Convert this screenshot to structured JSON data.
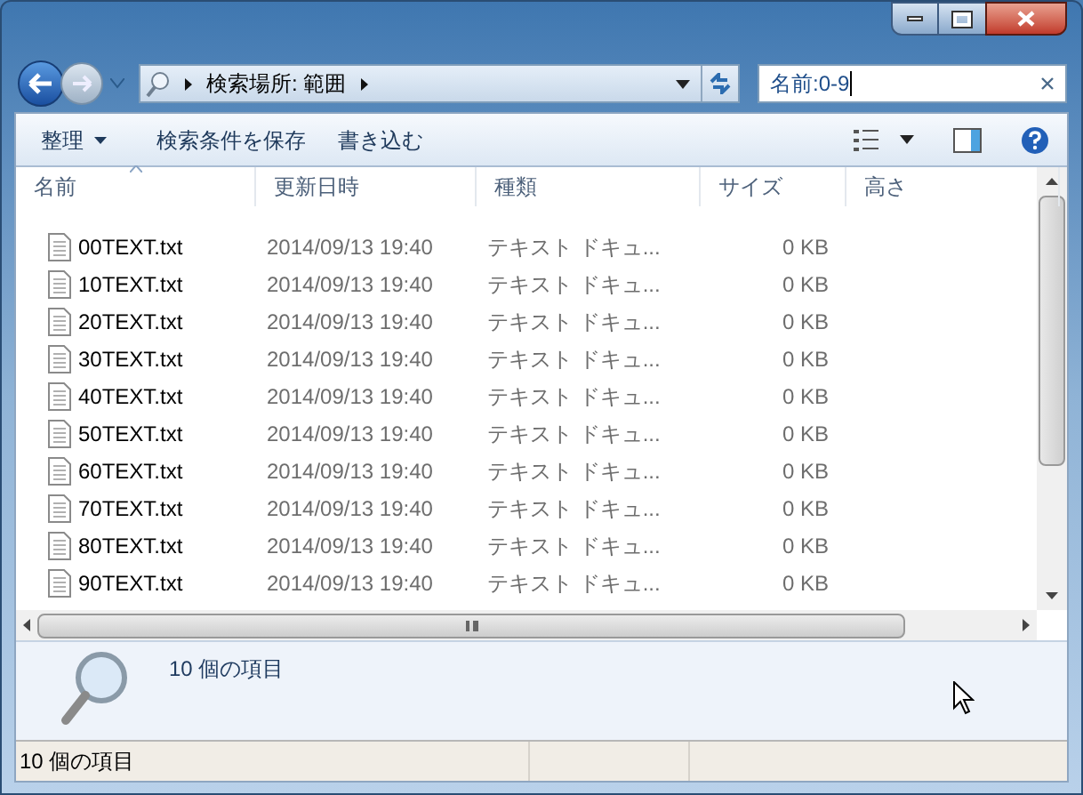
{
  "address": {
    "segments": [
      "検索場所: 範囲"
    ]
  },
  "search": {
    "value": "名前:0-9"
  },
  "toolbar": {
    "items": [
      {
        "label": "整理",
        "dropdown": true
      },
      {
        "label": "検索条件を保存",
        "dropdown": false
      },
      {
        "label": "書き込む",
        "dropdown": false
      }
    ]
  },
  "table": {
    "columns": [
      "名前",
      "更新日時",
      "種類",
      "サイズ",
      "高さ"
    ],
    "rows": [
      {
        "name": "00TEXT.txt",
        "modified": "2014/09/13 19:40",
        "type": "テキスト ドキュ...",
        "size": "0 KB"
      },
      {
        "name": "10TEXT.txt",
        "modified": "2014/09/13 19:40",
        "type": "テキスト ドキュ...",
        "size": "0 KB"
      },
      {
        "name": "20TEXT.txt",
        "modified": "2014/09/13 19:40",
        "type": "テキスト ドキュ...",
        "size": "0 KB"
      },
      {
        "name": "30TEXT.txt",
        "modified": "2014/09/13 19:40",
        "type": "テキスト ドキュ...",
        "size": "0 KB"
      },
      {
        "name": "40TEXT.txt",
        "modified": "2014/09/13 19:40",
        "type": "テキスト ドキュ...",
        "size": "0 KB"
      },
      {
        "name": "50TEXT.txt",
        "modified": "2014/09/13 19:40",
        "type": "テキスト ドキュ...",
        "size": "0 KB"
      },
      {
        "name": "60TEXT.txt",
        "modified": "2014/09/13 19:40",
        "type": "テキスト ドキュ...",
        "size": "0 KB"
      },
      {
        "name": "70TEXT.txt",
        "modified": "2014/09/13 19:40",
        "type": "テキスト ドキュ...",
        "size": "0 KB"
      },
      {
        "name": "80TEXT.txt",
        "modified": "2014/09/13 19:40",
        "type": "テキスト ドキュ...",
        "size": "0 KB"
      },
      {
        "name": "90TEXT.txt",
        "modified": "2014/09/13 19:40",
        "type": "テキスト ドキュ...",
        "size": "0 KB"
      }
    ]
  },
  "details_pane": {
    "summary": "10 個の項目"
  },
  "status_bar": {
    "text": "10 個の項目"
  }
}
